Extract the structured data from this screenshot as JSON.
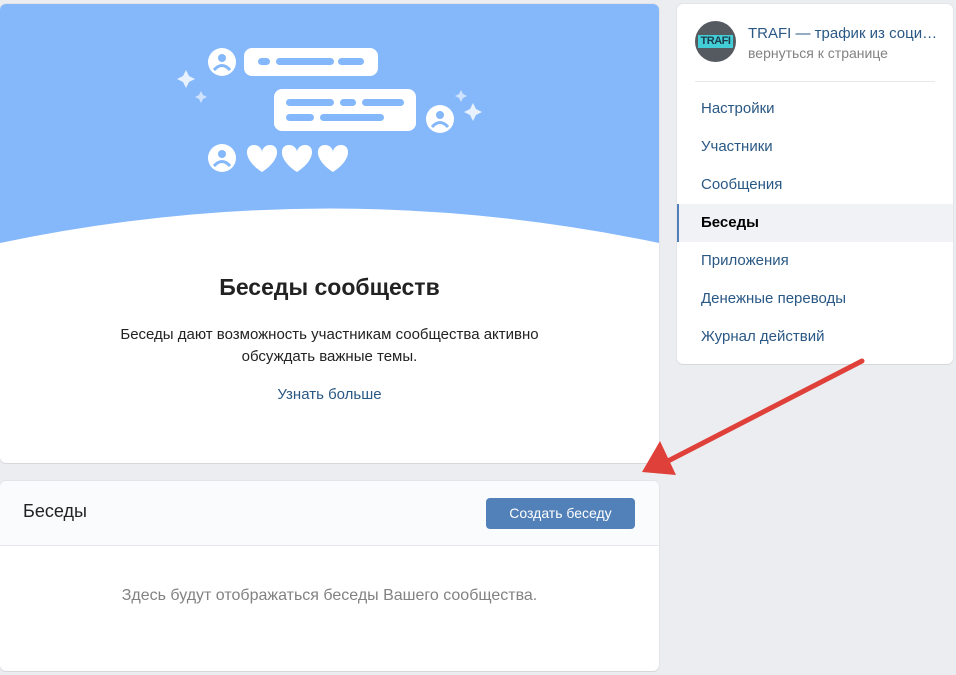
{
  "colors": {
    "banner_blue": "#84b8fa",
    "accent": "#5181b8",
    "link": "#2a5885",
    "annotation_arrow": "#e0403a",
    "avatar_badge": "#43cdd6"
  },
  "promo": {
    "title": "Беседы сообществ",
    "description": "Беседы дают возможность участникам сообщества активно обсуждать важные темы.",
    "learn_more": "Узнать больше",
    "illustration_icons": [
      "user-avatar-icon",
      "chat-bubble-icon",
      "heart-icon",
      "sparkle-icon"
    ]
  },
  "chats": {
    "title": "Беседы",
    "create_button": "Создать беседу",
    "empty_text": "Здесь будут отображаться беседы Вашего сообщества."
  },
  "group": {
    "avatar_text": "TRAFI",
    "name": "TRAFI — трафик из социальных сетей",
    "back_link": "вернуться к странице"
  },
  "menu": {
    "items": [
      {
        "label": "Настройки"
      },
      {
        "label": "Участники"
      },
      {
        "label": "Сообщения"
      },
      {
        "label": "Беседы"
      },
      {
        "label": "Приложения"
      },
      {
        "label": "Денежные переводы"
      },
      {
        "label": "Журнал действий"
      }
    ],
    "active_label": "Беседы"
  }
}
